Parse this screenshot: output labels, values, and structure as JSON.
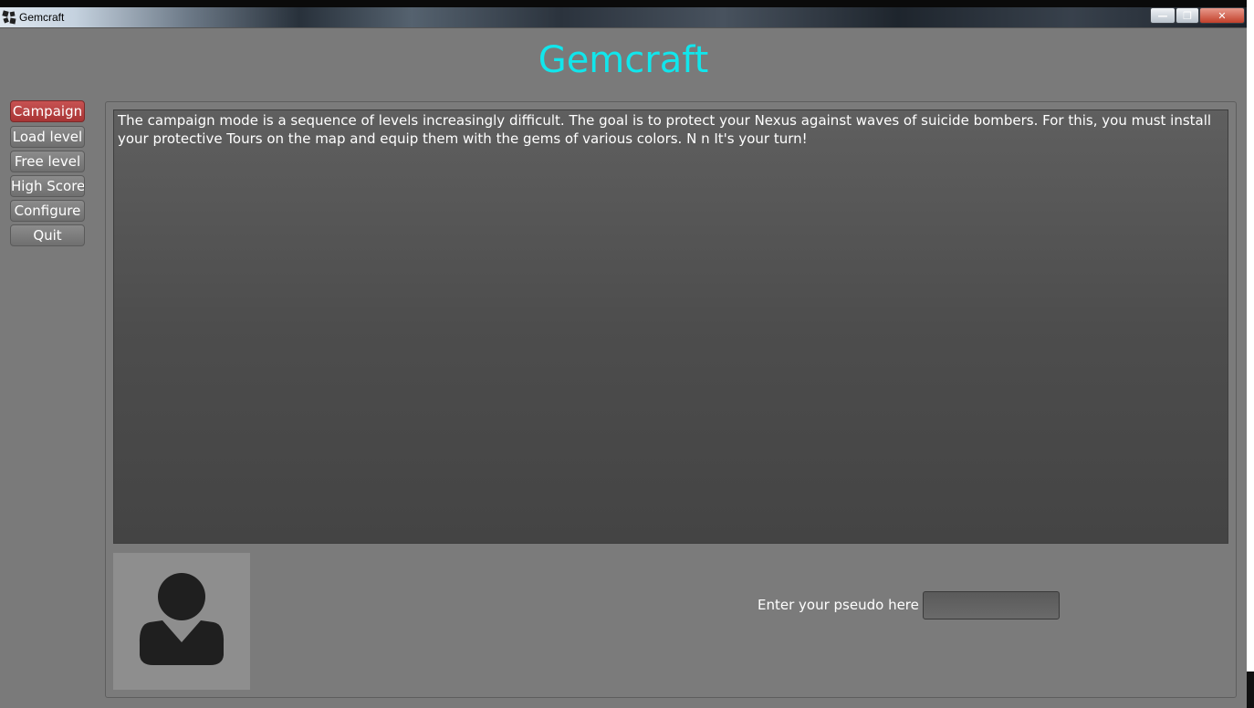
{
  "window": {
    "title": "Gemcraft",
    "minimize_glyph": "—",
    "maximize_glyph": "❐",
    "close_glyph": "✕"
  },
  "app": {
    "title": "Gemcraft",
    "title_color": "#11e6ec"
  },
  "menu": {
    "items": [
      {
        "label": "Campaign",
        "active": true
      },
      {
        "label": "Load level",
        "active": false
      },
      {
        "label": "Free level",
        "active": false
      },
      {
        "label": "High Score",
        "active": false
      },
      {
        "label": "Configure",
        "active": false
      },
      {
        "label": "Quit",
        "active": false
      }
    ],
    "active_color": "#b84242"
  },
  "main": {
    "description": "The campaign mode is a sequence of levels increasingly difficult. The goal is to protect your Nexus against waves of suicide bombers. For this, you must install your protective Tours on the map and equip them with the gems of various colors.  N  n It's your turn!",
    "avatar_icon": "user-silhouette-icon",
    "pseudo_label": "Enter your pseudo here :",
    "pseudo_value": "",
    "pseudo_placeholder": ""
  }
}
